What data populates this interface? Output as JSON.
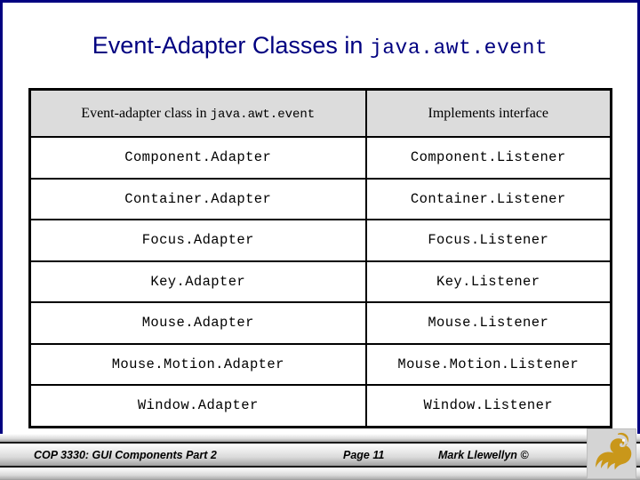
{
  "slide": {
    "title_text": "Event-Adapter Classes in ",
    "title_mono": "java.awt.event",
    "accent_color": "#000080",
    "header_bg_color": "#DCDCDC",
    "border_color": "#000000"
  },
  "table": {
    "headers": {
      "col1_text": "Event-adapter class in ",
      "col1_mono": "java.awt.event",
      "col2": "Implements interface"
    },
    "rows": [
      {
        "adapter": "Component.Adapter",
        "listener": "Component.Listener"
      },
      {
        "adapter": "Container.Adapter",
        "listener": "Container.Listener"
      },
      {
        "adapter": "Focus.Adapter",
        "listener": "Focus.Listener"
      },
      {
        "adapter": "Key.Adapter",
        "listener": "Key.Listener"
      },
      {
        "adapter": "Mouse.Adapter",
        "listener": "Mouse.Listener"
      },
      {
        "adapter": "Mouse.Motion.Adapter",
        "listener": "Mouse.Motion.Listener"
      },
      {
        "adapter": "Window.Adapter",
        "listener": "Window.Listener"
      }
    ]
  },
  "footer": {
    "course": "COP 3330: GUI Components Part 2",
    "page": "Page 11",
    "author": "Mark Llewellyn ©",
    "logo_name": "ucf-pegasus-logo",
    "logo_color": "#C9971A"
  }
}
